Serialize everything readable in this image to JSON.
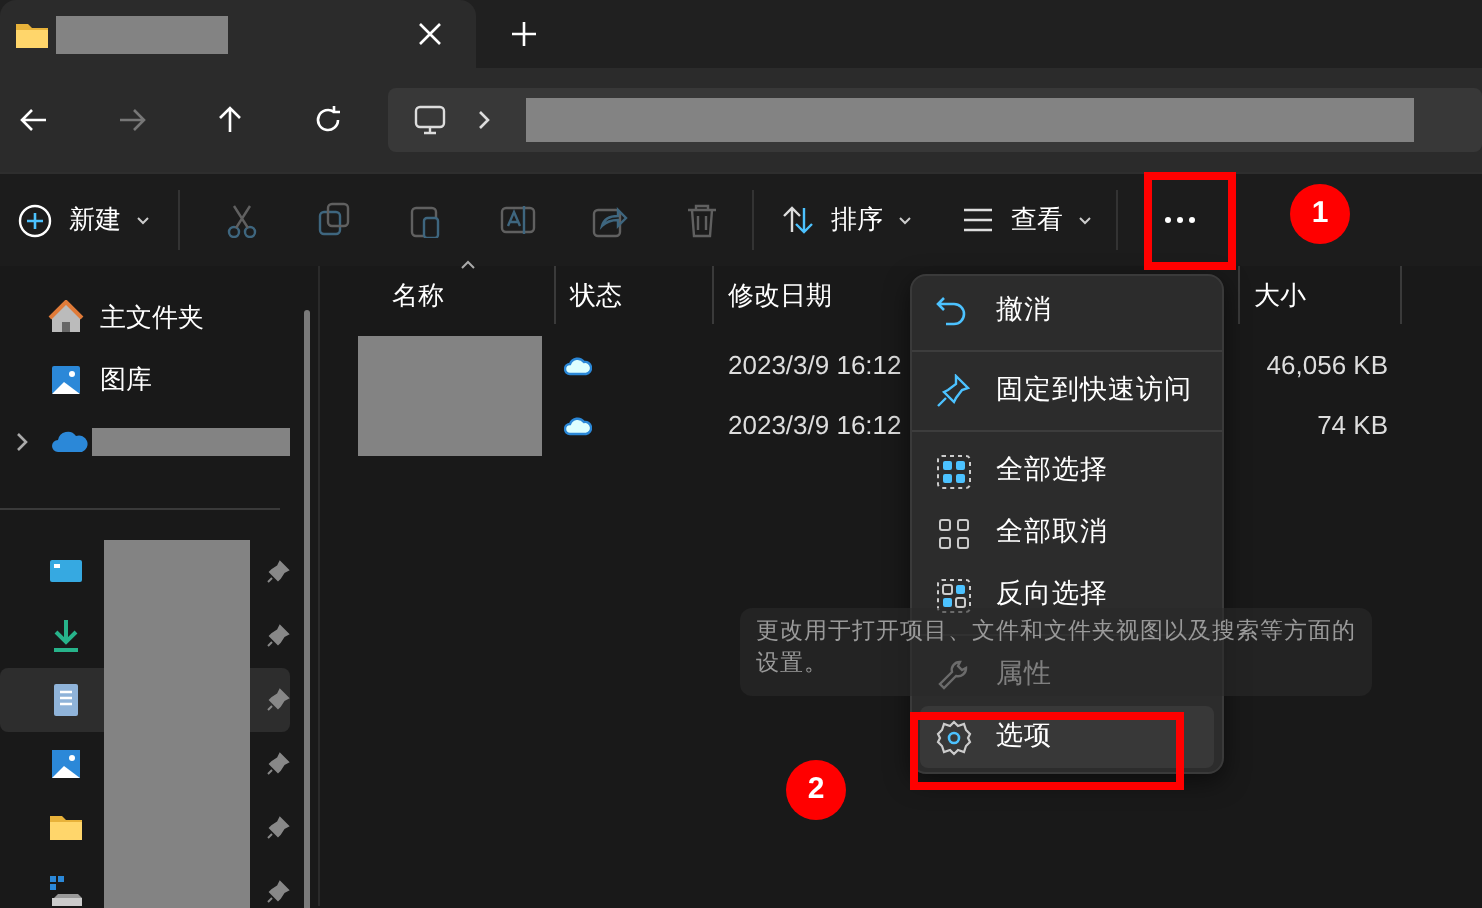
{
  "toolbar": {
    "new_button": {
      "label": "新建"
    },
    "actions": [
      {
        "kind": "cut",
        "disabled": true
      },
      {
        "kind": "copy",
        "disabled": true
      },
      {
        "kind": "paste",
        "disabled": true
      },
      {
        "kind": "rename",
        "disabled": true
      },
      {
        "kind": "share",
        "disabled": true
      },
      {
        "kind": "delete",
        "disabled": true
      }
    ],
    "sort_button": {
      "label": "排序"
    },
    "view_button": {
      "label": "查看"
    }
  },
  "sidebar": {
    "items": [
      {
        "kind": "home",
        "label": "主文件夹"
      },
      {
        "kind": "gallery",
        "label": "图库"
      },
      {
        "kind": "cloud"
      }
    ],
    "pinned": [
      {
        "kind": "desktop",
        "selected": false
      },
      {
        "kind": "download",
        "selected": false
      },
      {
        "kind": "document",
        "selected": true
      },
      {
        "kind": "pictures",
        "selected": false
      },
      {
        "kind": "folder",
        "selected": false
      },
      {
        "kind": "drive",
        "selected": false
      }
    ]
  },
  "table": {
    "columns": [
      "名称",
      "状态",
      "修改日期",
      "大小"
    ],
    "rows": [
      {
        "modified": "2023/3/9 16:12",
        "size": "46,056 KB"
      },
      {
        "modified": "2023/3/9 16:12",
        "size": "74 KB"
      }
    ]
  },
  "menu": {
    "groups": [
      [
        {
          "kind": "undo",
          "label": "撤消",
          "selected": false
        }
      ],
      [
        {
          "kind": "pin",
          "label": "固定到快速访问",
          "selected": false
        }
      ],
      [
        {
          "kind": "selectall",
          "label": "全部选择",
          "selected": false
        },
        {
          "kind": "selectnone",
          "label": "全部取消",
          "selected": false
        },
        {
          "kind": "invert",
          "label": "反向选择",
          "selected": false
        }
      ],
      [
        {
          "kind": "properties",
          "label": "属性",
          "selected": false
        },
        {
          "kind": "options",
          "label": "选项",
          "selected": true
        }
      ]
    ]
  },
  "tooltip": {
    "text": "更改用于打开项目、文件和文件夹视图以及搜索等方面的设置。"
  },
  "annotations": [
    {
      "label": "1"
    },
    {
      "label": "2"
    }
  ]
}
